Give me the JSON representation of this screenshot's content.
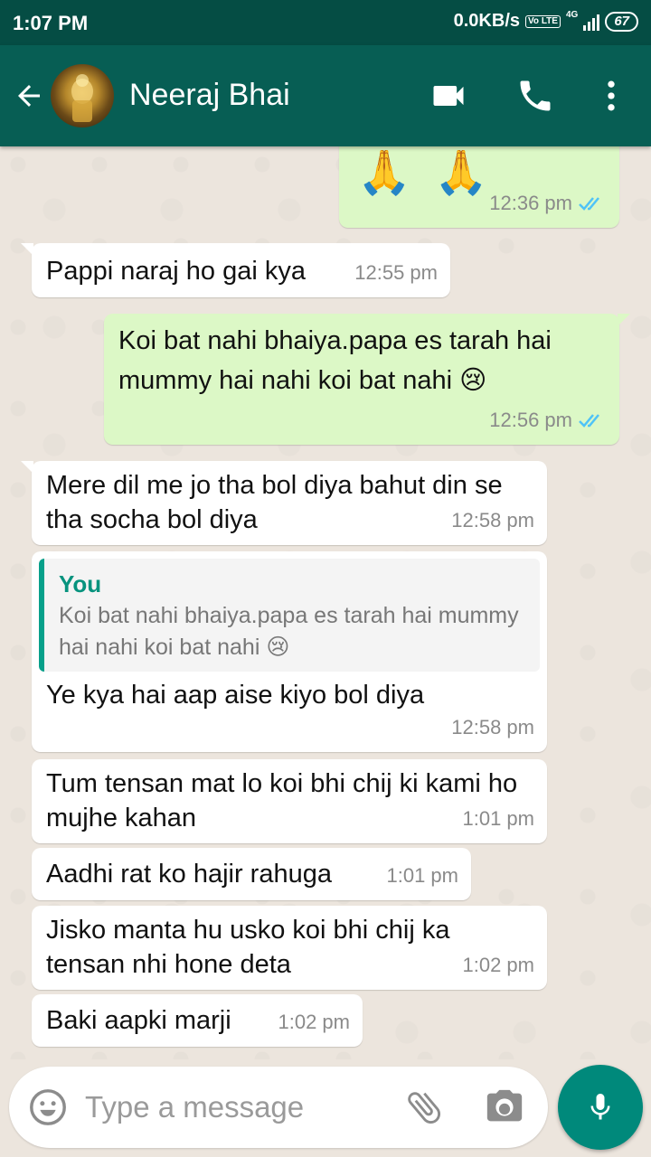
{
  "status_bar": {
    "time": "1:07 PM",
    "network_speed": "0.0KB/s",
    "volte": "Vo LTE",
    "network_type": "4G",
    "battery": "67"
  },
  "header": {
    "contact_name": "Neeraj Bhai",
    "icons": [
      "back-arrow-icon",
      "avatar",
      "video-call-icon",
      "phone-icon",
      "more-vert-icon"
    ]
  },
  "messages": [
    {
      "direction": "out",
      "text": "🙏 🙏",
      "time": "12:36 pm",
      "status": "read"
    },
    {
      "direction": "in",
      "text": "Pappi naraj ho gai kya",
      "time": "12:55 pm"
    },
    {
      "direction": "out",
      "text": "Koi bat nahi bhaiya.papa es tarah hai mummy hai nahi  koi bat nahi 😢",
      "time": "12:56 pm",
      "status": "read"
    },
    {
      "direction": "in",
      "text": "Mere dil me jo tha bol diya bahut din se tha socha bol diya",
      "time": "12:58 pm"
    },
    {
      "direction": "in",
      "quote_author": "You",
      "quote_text": "Koi bat nahi bhaiya.papa es tarah hai mummy hai nahi  koi bat nahi 😢",
      "text": "Ye kya hai aap aise kiyo bol diya",
      "time": "12:58 pm"
    },
    {
      "direction": "in",
      "text": "Tum tensan mat lo koi bhi chij ki kami ho mujhe kahan",
      "time": "1:01 pm"
    },
    {
      "direction": "in",
      "text": "Aadhi rat ko hajir rahuga",
      "time": "1:01 pm"
    },
    {
      "direction": "in",
      "text": "Jisko manta hu usko koi bhi chij ka tensan nhi hone deta",
      "time": "1:02 pm"
    },
    {
      "direction": "in",
      "text": "Baki aapki marji",
      "time": "1:02 pm"
    }
  ],
  "input": {
    "placeholder": "Type a message",
    "icons": [
      "emoji-icon",
      "attach-icon",
      "camera-icon",
      "mic-icon"
    ]
  },
  "colors": {
    "header": "#075e54",
    "status_bar": "#054d44",
    "outgoing_bubble": "#dcf8c6",
    "incoming_bubble": "#ffffff",
    "read_ticks": "#4fc3f7",
    "accent": "#00897b"
  }
}
